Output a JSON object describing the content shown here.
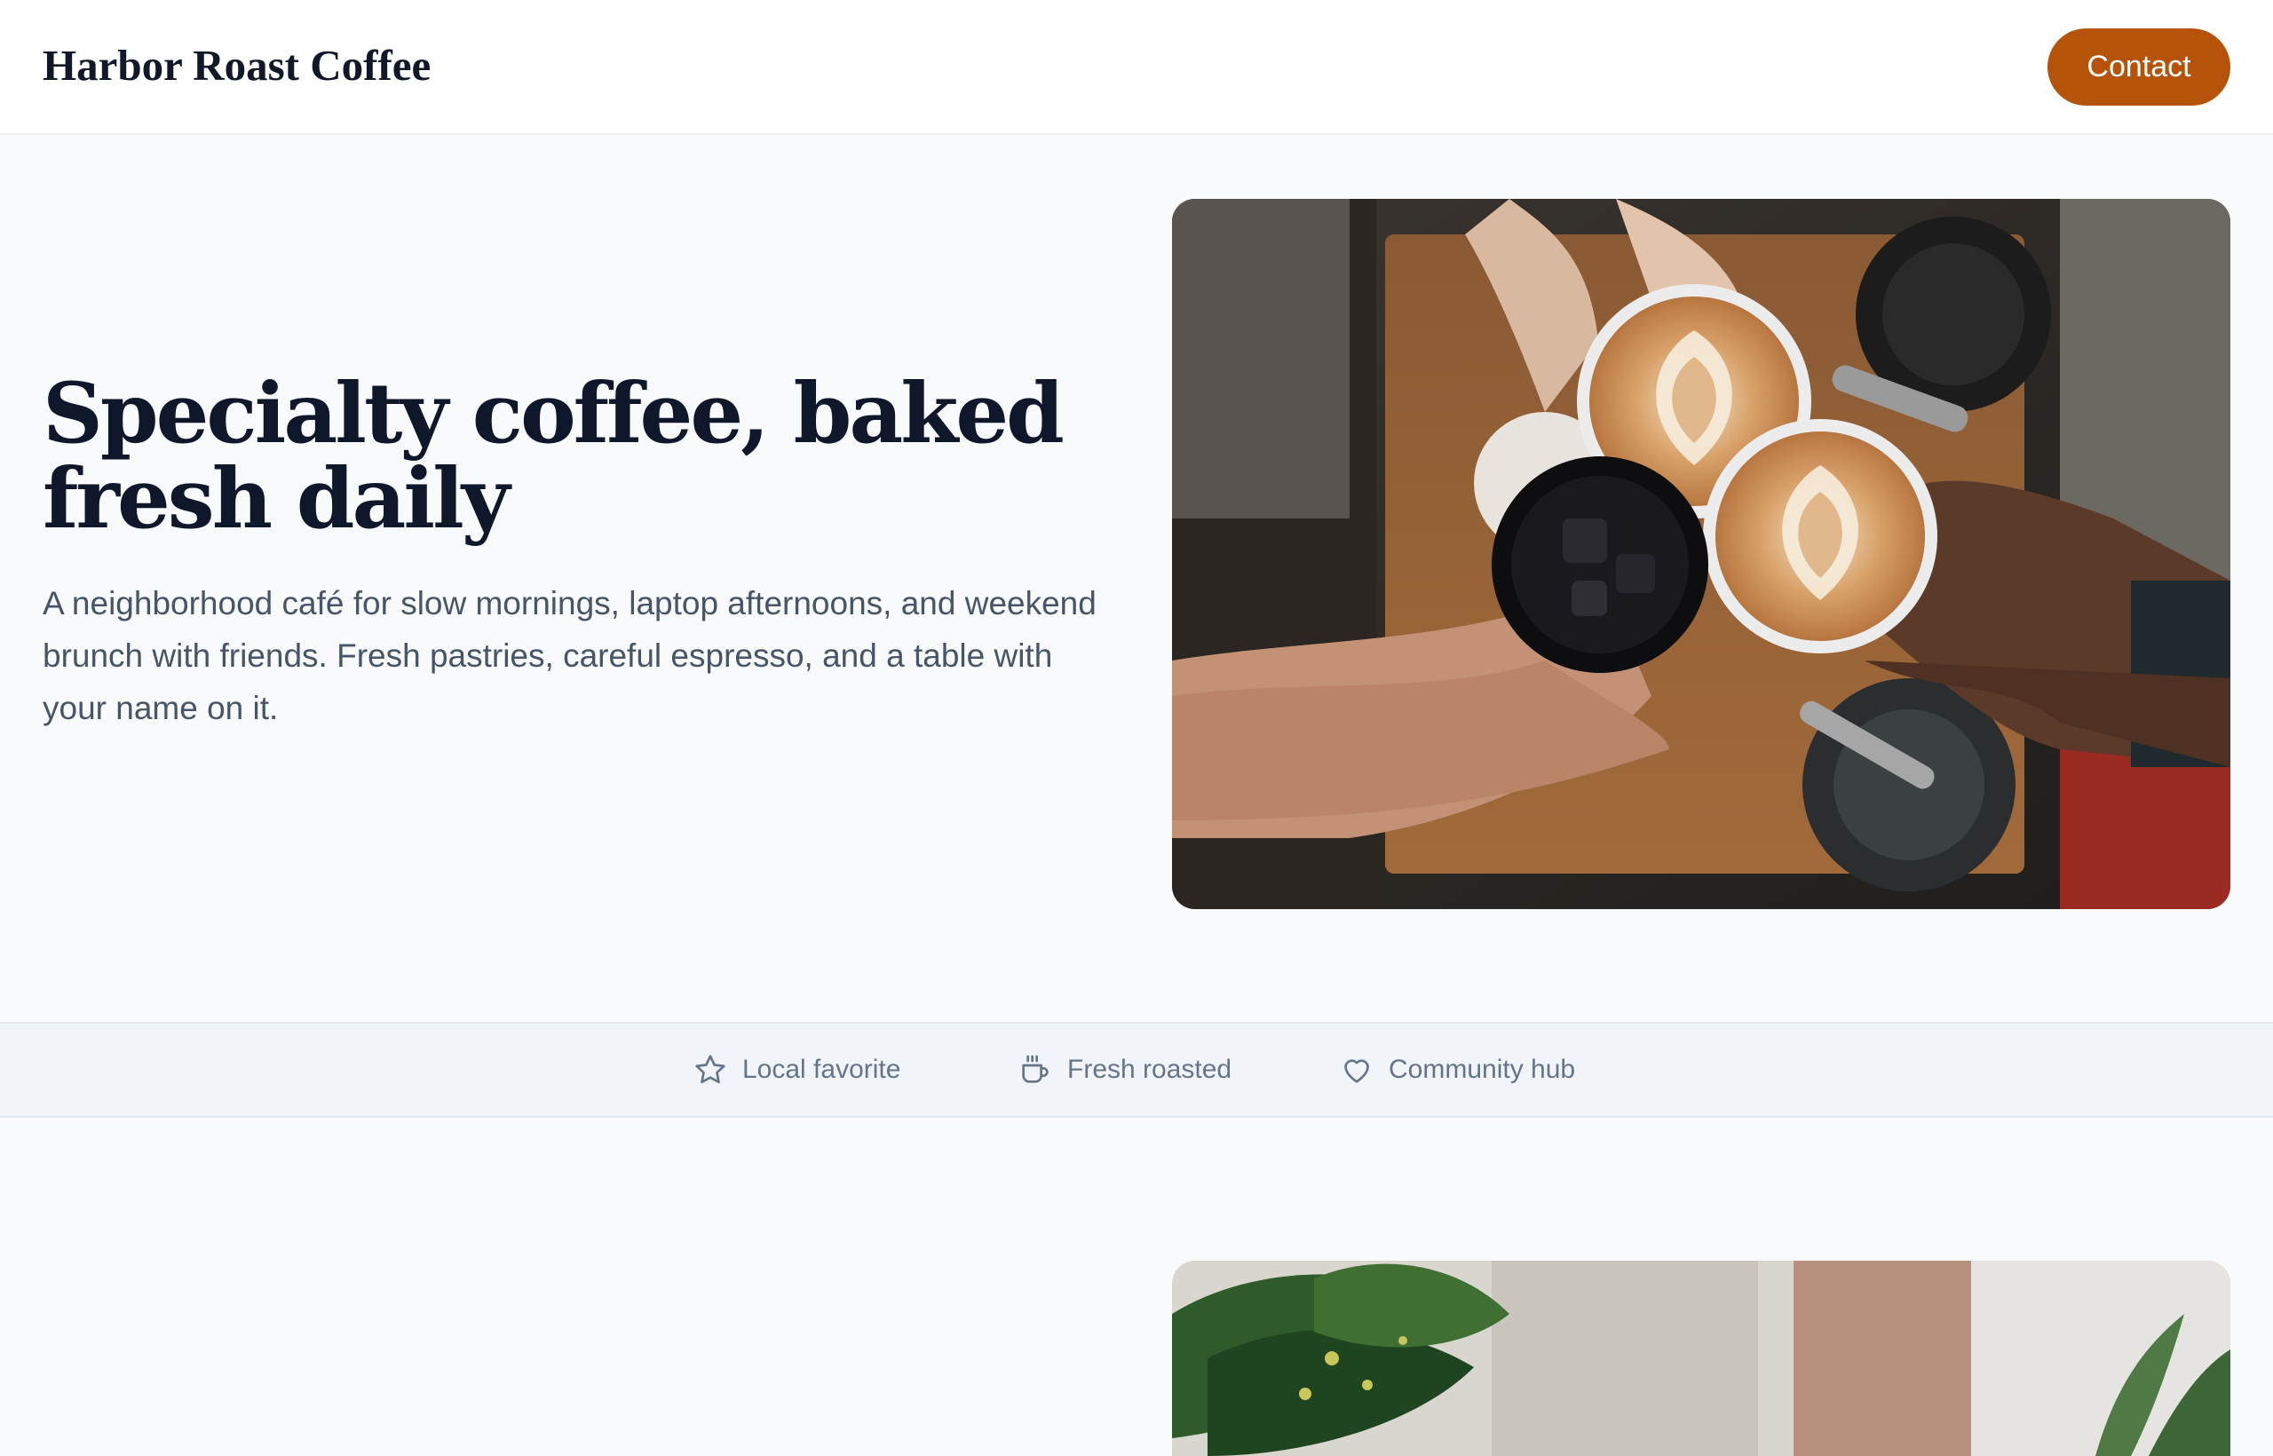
{
  "header": {
    "brand": "Harbor Roast Coffee",
    "contact_label": "Contact"
  },
  "hero": {
    "title": "Specialty coffee, baked fresh daily",
    "description": "A neighborhood café for slow mornings, laptop afternoons, and weekend brunch with friends. Fresh pastries, careful espresso, and a table with your name on it."
  },
  "badges": [
    {
      "icon": "star-icon",
      "label": "Local favorite"
    },
    {
      "icon": "coffee-cup-icon",
      "label": "Fresh roasted"
    },
    {
      "icon": "heart-icon",
      "label": "Community hub"
    }
  ],
  "colors": {
    "accent": "#b45309",
    "heading": "#0f172a",
    "body_text": "#475569",
    "page_background": "#f8fafc"
  }
}
